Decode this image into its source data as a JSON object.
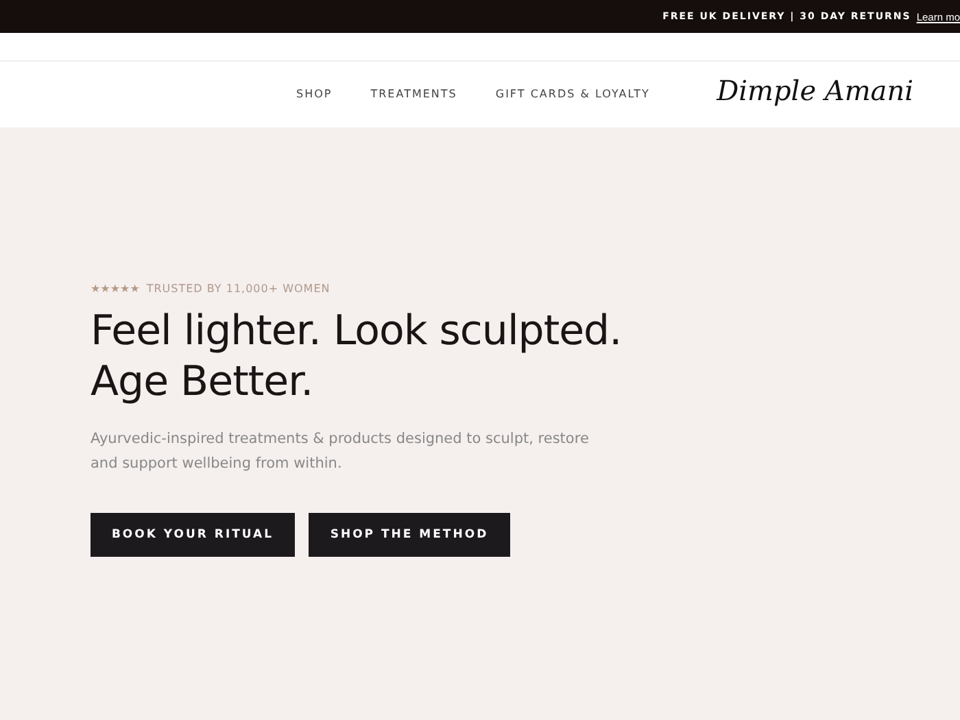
{
  "announcement": {
    "text": "FREE UK DELIVERY | 30 DAY RETURNS",
    "link": "Learn mo"
  },
  "nav": {
    "items": [
      {
        "label": "SHOP"
      },
      {
        "label": "TREATMENTS"
      },
      {
        "label": "GIFT CARDS & LOYALTY"
      }
    ],
    "logo": "Dimple Amani"
  },
  "hero": {
    "rating": {
      "stars": 5,
      "label": "TRUSTED BY 11,000+ WOMEN"
    },
    "headline": [
      "Feel lighter. Look sculpted.",
      "Age Better."
    ],
    "subtext": "Ayurvedic-inspired treatments & products designed to sculpt, restore and support wellbeing from within.",
    "buttons": [
      {
        "label": "BOOK YOUR RITUAL"
      },
      {
        "label": "SHOP THE METHOD"
      }
    ]
  }
}
